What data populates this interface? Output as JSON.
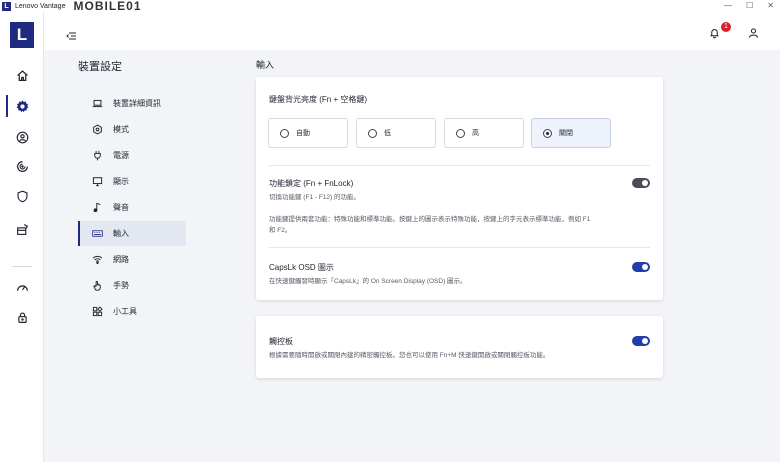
{
  "window": {
    "logo_letter": "L",
    "title": "Lenovo Vantage",
    "watermark": "MOBILE01",
    "minimize": "—",
    "maximize": "☐",
    "close": "✕"
  },
  "app": {
    "logo_letter": "L"
  },
  "topbar": {
    "notification_count": "1"
  },
  "nav": {
    "title": "裝置設定",
    "items": [
      {
        "label": "裝置詳細資訊",
        "icon": "laptop-icon"
      },
      {
        "label": "模式",
        "icon": "hexagon-icon"
      },
      {
        "label": "電源",
        "icon": "plug-icon"
      },
      {
        "label": "顯示",
        "icon": "monitor-icon"
      },
      {
        "label": "聲音",
        "icon": "music-note-icon"
      },
      {
        "label": "輸入",
        "icon": "keyboard-icon",
        "active": true
      },
      {
        "label": "網路",
        "icon": "wifi-icon"
      },
      {
        "label": "手勢",
        "icon": "hand-icon"
      },
      {
        "label": "小工具",
        "icon": "widgets-icon"
      }
    ]
  },
  "content": {
    "title": "輸入",
    "backlight": {
      "title": "鍵盤背光亮度 (Fn + 空格鍵)",
      "options": [
        {
          "label": "自動",
          "selected": false
        },
        {
          "label": "低",
          "selected": false
        },
        {
          "label": "高",
          "selected": false
        },
        {
          "label": "關閉",
          "selected": true
        }
      ]
    },
    "fnlock": {
      "title": "功能鎖定 (Fn + FnLock)",
      "subtitle": "切換功能鍵 (F1 - F12) 的功能。",
      "description_line1": "功能鍵提供兩套功能：特殊功能和標準功能。按鍵上的圖示表示特殊功能，按鍵上的字元表示標準功能，例如 F1",
      "description_line2": "和 F2。",
      "enabled": false
    },
    "capslock": {
      "title": "CapsLk OSD 圖示",
      "subtitle": "在快速鍵觸發時顯示「CapsLk」的 On Screen Display (OSD) 圖示。",
      "enabled": true
    },
    "touchpad": {
      "title": "觸控板",
      "subtitle": "根據需要隨時開啟或關閉內建的精密觸控板。您也可以使用 Fn+M 快速鍵開啟或關閉觸控板功能。",
      "enabled": true
    }
  },
  "colors": {
    "brand": "#1f2a80",
    "toggle_on": "#1f3fa8",
    "toggle_off": "#4a4e57",
    "badge": "#d6202a"
  }
}
